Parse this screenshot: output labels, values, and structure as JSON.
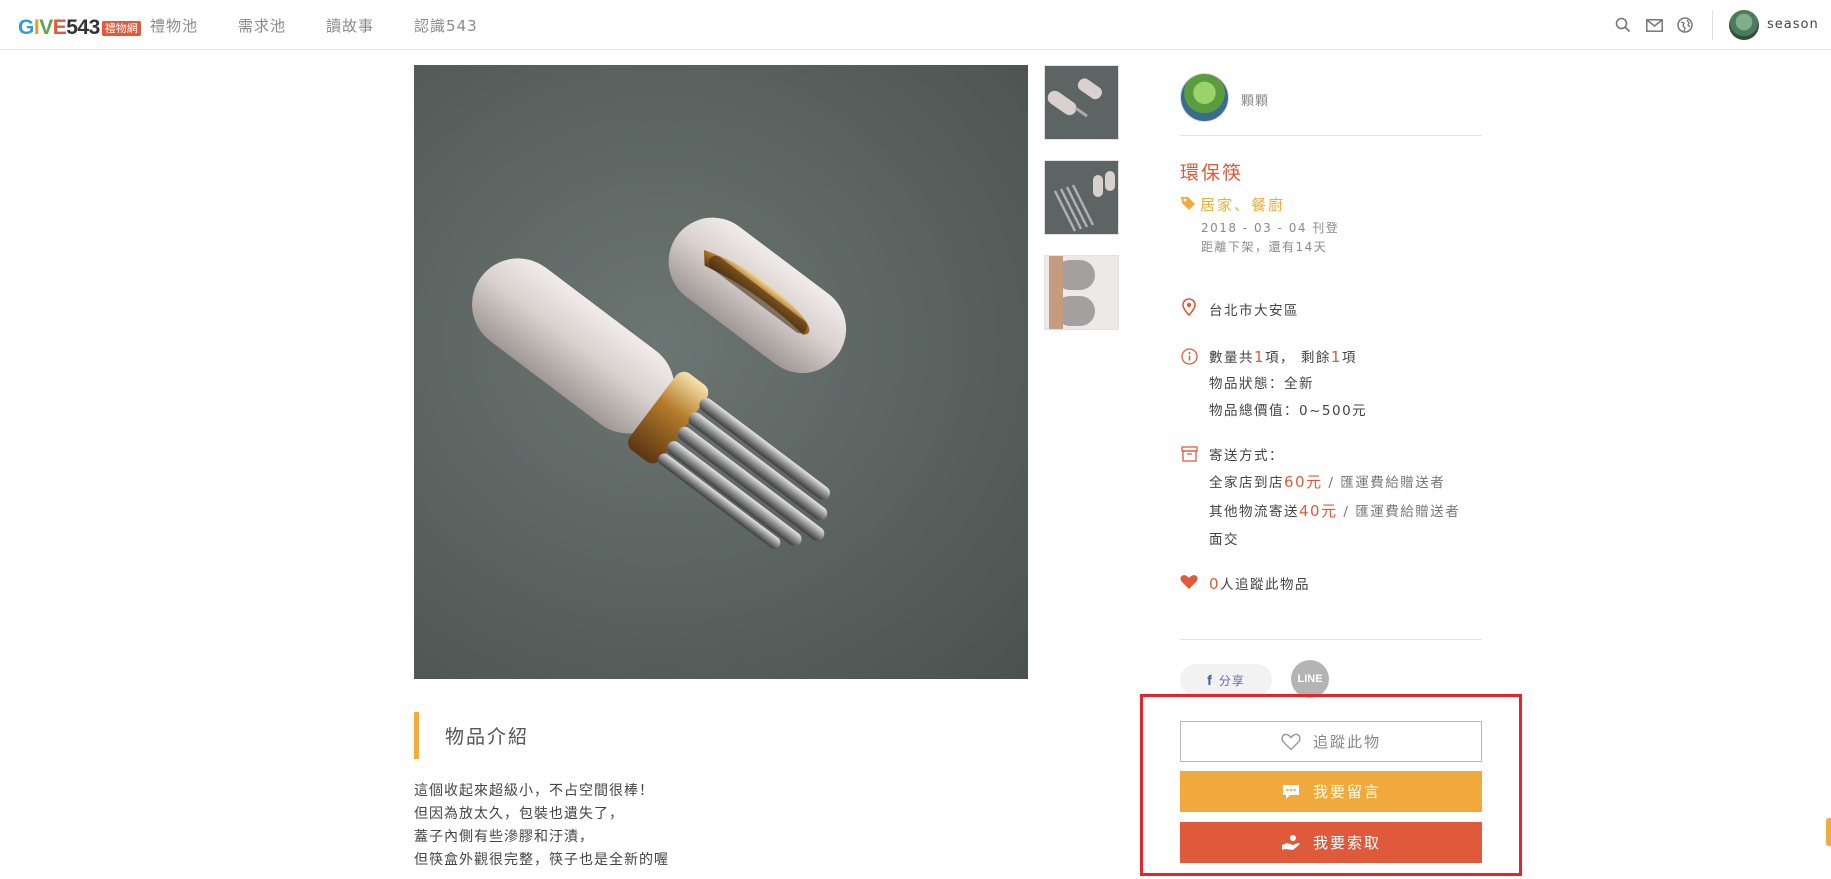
{
  "header": {
    "logo_main": "GIVE543",
    "logo_sub": "禮物網",
    "nav": [
      "禮物池",
      "需求池",
      "讀故事",
      "認識543"
    ],
    "username": "season"
  },
  "owner": {
    "name": "顆顆"
  },
  "item": {
    "title": "環保筷",
    "tag": "居家、餐廚",
    "posted": "2018 - 03 - 04 刊登",
    "remaining": "距離下架，還有14天",
    "location": "台北市大安區",
    "qty_prefix": "數量共",
    "qty_total": "1",
    "qty_mid": "項，  剩餘",
    "qty_left": "1",
    "qty_suffix": "項",
    "condition": "物品狀態：全新",
    "value": "物品總價值：0~500元",
    "shipping_label": "寄送方式：",
    "ship1_name": "全家店到店",
    "ship1_price": "60元",
    "ship1_note": "/ 匯運費給贈送者",
    "ship2_name": "其他物流寄送",
    "ship2_price": "40元",
    "ship2_note": "/ 匯運費給贈送者",
    "ship3_name": "面交",
    "followers": "0",
    "followers_suffix": "人追蹤此物品"
  },
  "share": {
    "fb_label": "分享",
    "line_label": "LINE"
  },
  "buttons": {
    "track": "追蹤此物",
    "comment": "我要留言",
    "request": "我要索取"
  },
  "intro": {
    "title": "物品介紹",
    "lines": [
      "這個收起來超級小，不占空間很棒！",
      "但因為放太久，包裝也遺失了，",
      "蓋子內側有些滲膠和汙漬，",
      "但筷盒外觀很完整，筷子也是全新的喔"
    ]
  },
  "colors": {
    "accent_red": "#e05a3a",
    "accent_orange": "#f2a93b",
    "highlight": "#e8242a"
  }
}
